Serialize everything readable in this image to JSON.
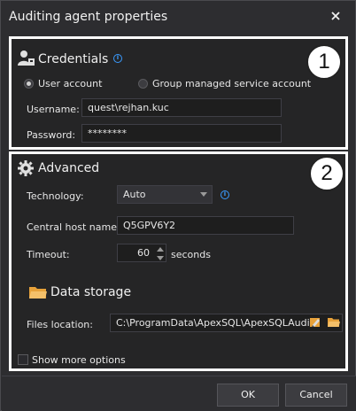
{
  "window": {
    "title": "Auditing agent properties"
  },
  "credentials": {
    "title": "Credentials",
    "badge": "1",
    "radio_user": "User account",
    "radio_gmsa": "Group managed service account",
    "username_label": "Username:",
    "username_value": "quest\\rejhan.kuc",
    "password_label": "Password:",
    "password_value": "********"
  },
  "advanced": {
    "title": "Advanced",
    "badge": "2",
    "technology_label": "Technology:",
    "technology_value": "Auto",
    "host_label": "Central host name:",
    "host_value": "Q5GPV6Y2",
    "timeout_label": "Timeout:",
    "timeout_value": "60",
    "timeout_unit": "seconds",
    "storage_title": "Data storage",
    "files_label": "Files location:",
    "files_value": "C:\\ProgramData\\ApexSQL\\ApexSQLAudit",
    "show_more": "Show more options"
  },
  "footer": {
    "ok": "OK",
    "cancel": "Cancel"
  },
  "colors": {
    "accent": "#3a9bff",
    "folder": "#e8a23a",
    "panel_border": "#ffffff"
  }
}
